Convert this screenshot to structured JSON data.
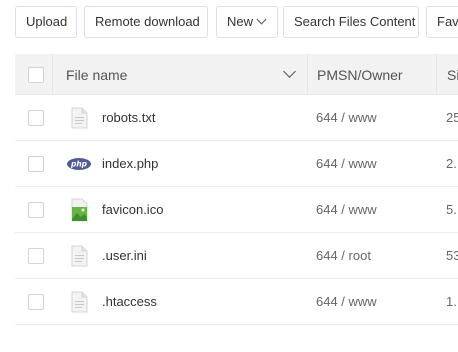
{
  "toolbar": {
    "upload": "Upload",
    "remote_download": "Remote download",
    "new": "New",
    "search_files": "Search Files Content",
    "favorites": "Fav"
  },
  "table": {
    "headers": {
      "name": "File name",
      "owner": "PMSN/Owner",
      "size": "Si"
    },
    "rows": [
      {
        "name": "robots.txt",
        "perm": "644 / www",
        "size": "25",
        "icon": "text-file-icon"
      },
      {
        "name": "index.php",
        "perm": "644 / www",
        "size": "2.",
        "icon": "php-file-icon"
      },
      {
        "name": "favicon.ico",
        "perm": "644 / www",
        "size": "5.",
        "icon": "image-file-icon"
      },
      {
        "name": ".user.ini",
        "perm": "644 / root",
        "size": "53",
        "icon": "text-file-icon"
      },
      {
        "name": ".htaccess",
        "perm": "644 / www",
        "size": "1.",
        "icon": "text-file-icon"
      }
    ]
  }
}
